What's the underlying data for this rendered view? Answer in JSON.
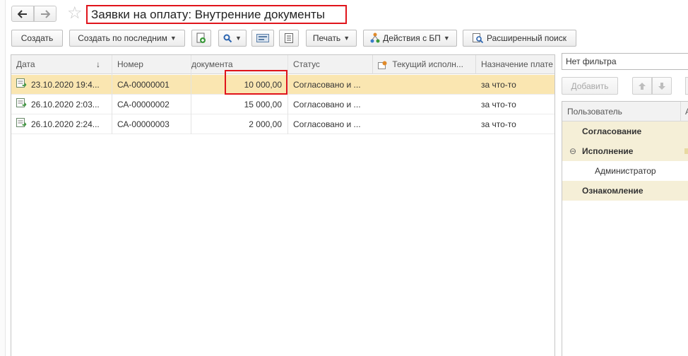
{
  "window": {
    "title": "Заявки на оплату: Внутренние документы"
  },
  "toolbar": {
    "create_label": "Создать",
    "create_by_last_label": "Создать по последним",
    "print_label": "Печать",
    "bp_actions_label": "Действия с БП",
    "advanced_search_label": "Расширенный поиск"
  },
  "list": {
    "columns": [
      "Дата",
      "Номер",
      "документа",
      "Статус",
      "Текущий исполн...",
      "Назначение плате"
    ],
    "sort_indicator": "↓",
    "rows": [
      {
        "date": "23.10.2020 19:4...",
        "number": "СА-00000001",
        "amount": "10 000,00",
        "status": "Согласовано и ...",
        "executor": "",
        "purpose": "за что-то",
        "selected": true
      },
      {
        "date": "26.10.2020 2:03...",
        "number": "СА-00000002",
        "amount": "15 000,00",
        "status": "Согласовано и ...",
        "executor": "",
        "purpose": "за что-то",
        "selected": false
      },
      {
        "date": "26.10.2020 2:24...",
        "number": "СА-00000003",
        "amount": "2 000,00",
        "status": "Согласовано и ...",
        "executor": "",
        "purpose": "за что-то",
        "selected": false
      }
    ]
  },
  "right_panel": {
    "filter_value": "Нет фильтра",
    "add_label": "Добавить",
    "columns": [
      "Пользователь",
      "А"
    ],
    "tree": [
      {
        "label": "Согласование",
        "group": true
      },
      {
        "label": "Исполнение",
        "group": true,
        "toggle": "⊖"
      },
      {
        "label": "Администратор",
        "group": false
      },
      {
        "label": "Ознакомление",
        "group": true
      }
    ]
  },
  "colors": {
    "selection": "#fae6b1",
    "group_row": "#f5efd7",
    "highlight_red": "#e0141b"
  }
}
